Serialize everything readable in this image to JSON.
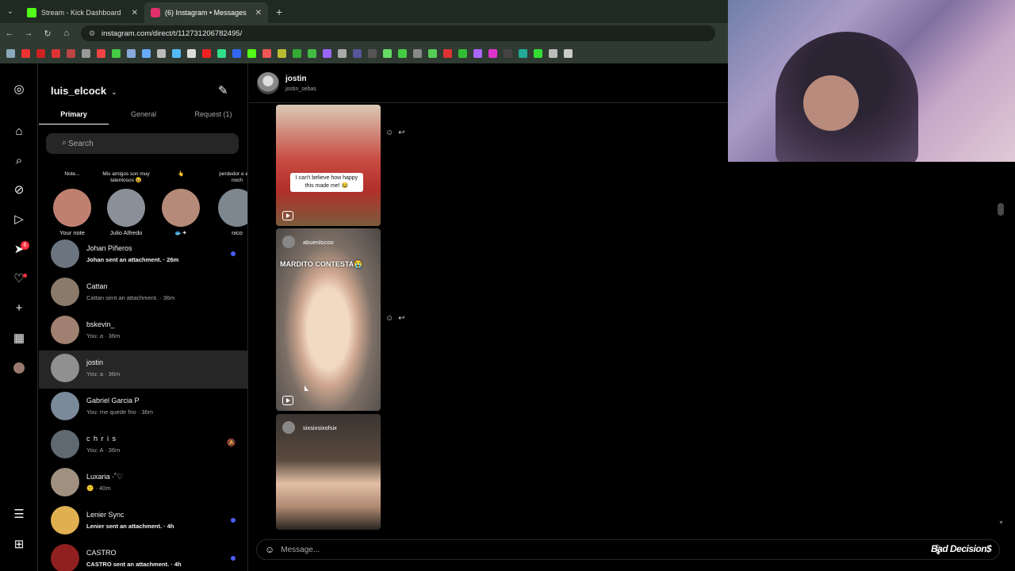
{
  "browser": {
    "tabs": [
      {
        "title": "Stream - Kick Dashboard",
        "favicon_color": "#53fc18",
        "active": false
      },
      {
        "title": "(6) Instagram • Messages",
        "favicon_color": "#e1306c",
        "active": true
      }
    ],
    "url": "instagram.com/direct/t/112731206782495/"
  },
  "inbox": {
    "username": "luis_elcock",
    "tabs": [
      "Primary",
      "General",
      "Request (1)"
    ],
    "search_placeholder": "Search",
    "notes": [
      {
        "bubble": "Note...",
        "name": "Your note",
        "color": "#c08070"
      },
      {
        "bubble": "Mis amigos son muy talentosos 😆",
        "name": "Julio Alfredo",
        "color": "#8a8f99"
      },
      {
        "bubble": "👆",
        "name": "🐟✦",
        "color": "#b58a78"
      },
      {
        "bubble": "perdedor e esta noch",
        "name": "nico",
        "color": "#7d8790"
      }
    ],
    "threads": [
      {
        "name": "Johan Piñeros",
        "preview": "Johan sent an attachment. · 26m",
        "unread": true,
        "color": "#6b7580"
      },
      {
        "name": "Cattan",
        "preview": "Cattan sent an attachment. · 36m",
        "unread": false,
        "color": "#8a7a6a"
      },
      {
        "name": "bskevin_",
        "preview": "You: a · 36m",
        "unread": false,
        "color": "#a08070"
      },
      {
        "name": "jostin",
        "preview": "You: a · 36m",
        "unread": false,
        "selected": true,
        "color": "#909090"
      },
      {
        "name": "Gabriel Garcia P",
        "preview": "You: me quede frio · 36m",
        "unread": false,
        "color": "#7a8a9a"
      },
      {
        "name": "c h r i s",
        "preview": "You: A · 36m",
        "unread": false,
        "muted": true,
        "color": "#606870"
      },
      {
        "name": "Luxaria ·˚♡",
        "preview": "🙂 · 40m",
        "unread": false,
        "color": "#a09080"
      },
      {
        "name": "Lenier Sync",
        "preview": "Lenier sent an attachment. · 4h",
        "unread": true,
        "color": "#e0b050"
      },
      {
        "name": "CASTRO",
        "preview": "CASTRO sent an attachment. · 4h",
        "unread": true,
        "color": "#902020"
      }
    ]
  },
  "chat": {
    "name": "jostin",
    "handle": "jostin_sebas",
    "messages": [
      {
        "caption": "I can't believe how happy this made me! 😂"
      },
      {
        "user": "abuenlocoo",
        "headline": "MARDITO CONTESTA😭"
      },
      {
        "user": "sixsixsixofsix"
      }
    ],
    "input_placeholder": "Message..."
  },
  "overlay": {
    "watermark": "Bad Decision$"
  },
  "rail": {
    "notification_count": "6"
  }
}
